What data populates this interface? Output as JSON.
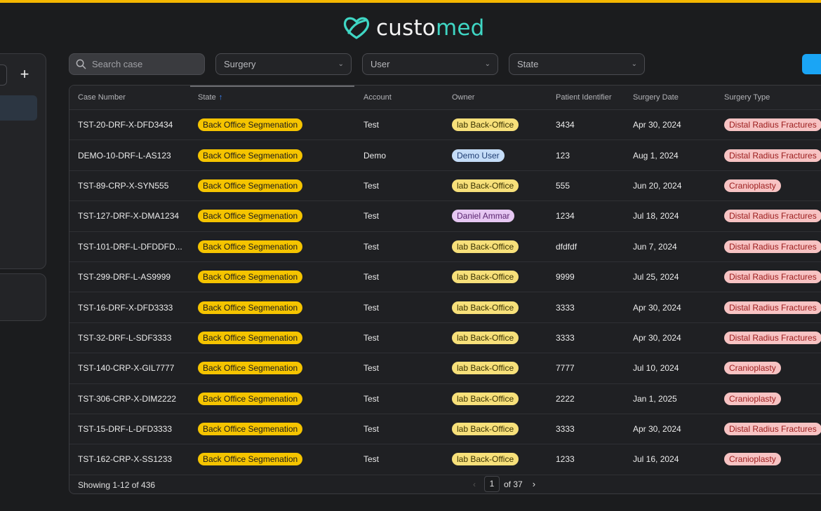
{
  "brand": {
    "part1": "custo",
    "part2": "med"
  },
  "colors": {
    "accent_top": "#f5b700",
    "brand_teal": "#3fd6c4",
    "primary_blue": "#1aa5f5",
    "state_badge": "#f5c400"
  },
  "sidebar": {
    "add_icon": "plus-icon"
  },
  "filters": {
    "search_placeholder": "Search case",
    "surgery": "Surgery",
    "user": "User",
    "state": "State"
  },
  "table": {
    "columns": {
      "case_number": "Case Number",
      "state": "State",
      "account": "Account",
      "owner": "Owner",
      "patient_identifier": "Patient Identifier",
      "surgery_date": "Surgery Date",
      "surgery_type": "Surgery Type"
    },
    "rows": [
      {
        "case": "TST-20-DRF-X-DFD3434",
        "state": "Back Office Segmenation",
        "account": "Test",
        "owner": "lab Back-Office",
        "patient": "3434",
        "date": "Apr 30, 2024",
        "type": "Distal Radius Fractures"
      },
      {
        "case": "DEMO-10-DRF-L-AS123",
        "state": "Back Office Segmenation",
        "account": "Demo",
        "owner": "Demo User",
        "patient": "123",
        "date": "Aug 1, 2024",
        "type": "Distal Radius Fractures"
      },
      {
        "case": "TST-89-CRP-X-SYN555",
        "state": "Back Office Segmenation",
        "account": "Test",
        "owner": "lab Back-Office",
        "patient": "555",
        "date": "Jun 20, 2024",
        "type": "Cranioplasty"
      },
      {
        "case": "TST-127-DRF-X-DMA1234",
        "state": "Back Office Segmenation",
        "account": "Test",
        "owner": "Daniel Ammar",
        "patient": "1234",
        "date": "Jul 18, 2024",
        "type": "Distal Radius Fractures"
      },
      {
        "case": "TST-101-DRF-L-DFDDFD...",
        "state": "Back Office Segmenation",
        "account": "Test",
        "owner": "lab Back-Office",
        "patient": "dfdfdf",
        "date": "Jun 7, 2024",
        "type": "Distal Radius Fractures"
      },
      {
        "case": "TST-299-DRF-L-AS9999",
        "state": "Back Office Segmenation",
        "account": "Test",
        "owner": "lab Back-Office",
        "patient": "9999",
        "date": "Jul 25, 2024",
        "type": "Distal Radius Fractures"
      },
      {
        "case": "TST-16-DRF-X-DFD3333",
        "state": "Back Office Segmenation",
        "account": "Test",
        "owner": "lab Back-Office",
        "patient": "3333",
        "date": "Apr 30, 2024",
        "type": "Distal Radius Fractures"
      },
      {
        "case": "TST-32-DRF-L-SDF3333",
        "state": "Back Office Segmenation",
        "account": "Test",
        "owner": "lab Back-Office",
        "patient": "3333",
        "date": "Apr 30, 2024",
        "type": "Distal Radius Fractures"
      },
      {
        "case": "TST-140-CRP-X-GIL7777",
        "state": "Back Office Segmenation",
        "account": "Test",
        "owner": "lab Back-Office",
        "patient": "7777",
        "date": "Jul 10, 2024",
        "type": "Cranioplasty"
      },
      {
        "case": "TST-306-CRP-X-DIM2222",
        "state": "Back Office Segmenation",
        "account": "Test",
        "owner": "lab Back-Office",
        "patient": "2222",
        "date": "Jan 1, 2025",
        "type": "Cranioplasty"
      },
      {
        "case": "TST-15-DRF-L-DFD3333",
        "state": "Back Office Segmenation",
        "account": "Test",
        "owner": "lab Back-Office",
        "patient": "3333",
        "date": "Apr 30, 2024",
        "type": "Distal Radius Fractures"
      },
      {
        "case": "TST-162-CRP-X-SS1233",
        "state": "Back Office Segmenation",
        "account": "Test",
        "owner": "lab Back-Office",
        "patient": "1233",
        "date": "Jul 16, 2024",
        "type": "Cranioplasty"
      }
    ]
  },
  "footer": {
    "showing": "Showing 1-12 of 436",
    "current_page": "1",
    "of_pages": "of 37"
  }
}
